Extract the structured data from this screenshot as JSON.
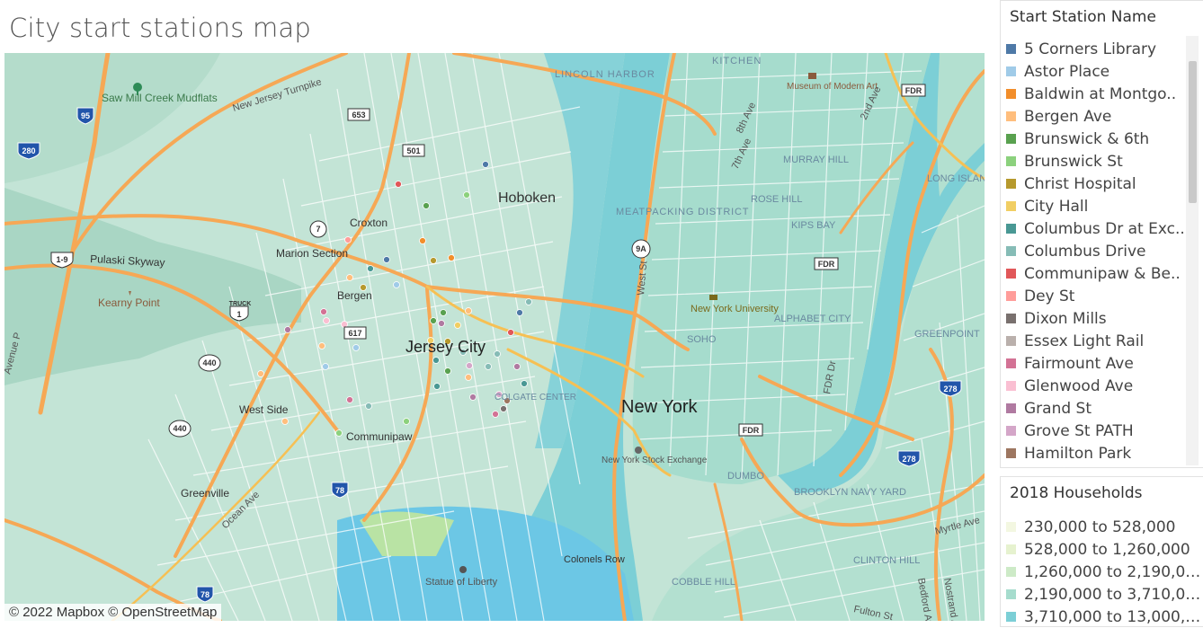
{
  "title": "City start stations map",
  "station_legend": {
    "title": "Start Station Name",
    "items": [
      {
        "label": "5 Corners Library",
        "color": "#4e79a7"
      },
      {
        "label": "Astor Place",
        "color": "#a0cbe8"
      },
      {
        "label": "Baldwin at Montgo..",
        "color": "#f28e2b"
      },
      {
        "label": "Bergen Ave",
        "color": "#ffbe7d"
      },
      {
        "label": "Brunswick & 6th",
        "color": "#59a14f"
      },
      {
        "label": "Brunswick St",
        "color": "#8cd17d"
      },
      {
        "label": "Christ Hospital",
        "color": "#b6992d"
      },
      {
        "label": "City Hall",
        "color": "#f1ce63"
      },
      {
        "label": "Columbus Dr at Exc..",
        "color": "#499894"
      },
      {
        "label": "Columbus Drive",
        "color": "#86bcb6"
      },
      {
        "label": "Communipaw & Be..",
        "color": "#e15759"
      },
      {
        "label": "Dey St",
        "color": "#ff9d9a"
      },
      {
        "label": "Dixon Mills",
        "color": "#79706e"
      },
      {
        "label": "Essex Light Rail",
        "color": "#bab0ac"
      },
      {
        "label": "Fairmount Ave",
        "color": "#d37295"
      },
      {
        "label": "Glenwood Ave",
        "color": "#fabfd2"
      },
      {
        "label": "Grand St",
        "color": "#b07aa1"
      },
      {
        "label": "Grove St PATH",
        "color": "#d4a6c8"
      },
      {
        "label": "Hamilton Park",
        "color": "#9d7660"
      }
    ]
  },
  "households_legend": {
    "title": "2018 Households",
    "items": [
      {
        "label": "230,000 to 528,000",
        "color": "#f3f7e1"
      },
      {
        "label": "528,000 to 1,260,000",
        "color": "#e6f2cf"
      },
      {
        "label": "1,260,000 to 2,190,000",
        "color": "#cdeac7"
      },
      {
        "label": "2,190,000 to 3,710,000",
        "color": "#a6dccd"
      },
      {
        "label": "3,710,000 to 13,000,0..",
        "color": "#7ccfd6"
      }
    ]
  },
  "map": {
    "attribution": "© 2022 Mapbox © OpenStreetMap",
    "places": {
      "saw_mill": "Saw Mill Creek Mudflats",
      "nj_turnpike": "New Jersey Turnpike",
      "lincoln_harbor": "LINCOLN HARBOR",
      "kitchen": "KITCHEN",
      "moma": "Museum of Modern Art",
      "hoboken": "Hoboken",
      "croxton": "Croxton",
      "marion": "Marion Section",
      "pulaski": "Pulaski Skyway",
      "kearny": "Kearny Point",
      "bergen": "Bergen",
      "jersey_city": "Jersey City",
      "colgate": "COLGATE CENTER",
      "west_side": "West Side",
      "communipaw": "Communipaw",
      "greenville": "Greenville",
      "ocean_ave": "Ocean Ave",
      "avenue_p": "Avenue P",
      "meatpacking": "MEATPACKING DISTRICT",
      "west_st": "West St",
      "nyu": "New York University",
      "soho": "SOHO",
      "new_york": "New York",
      "nyse": "New York Stock Exchange",
      "murray_hill": "MURRAY HILL",
      "rose_hill": "ROSE HILL",
      "kips_bay": "KIPS BAY",
      "alphabet_city": "ALPHABET CITY",
      "long_island_city": "LONG ISLAND CITY",
      "greenpoint": "GREENPOINT",
      "dumbo": "DUMBO",
      "brooklyn_navy": "BROOKLYN NAVY YARD",
      "clinton_hill": "CLINTON HILL",
      "cobble_hill": "COBBLE HILL",
      "statue": "Statue of Liberty",
      "colonels_row": "Colonels Row",
      "fdr_dr": "FDR Dr",
      "seventh_ave": "7th Ave",
      "eighth_ave": "8th Ave",
      "second_ave": "2nd Ave",
      "myrtle": "Myrtle Ave",
      "bedford": "Bedford Ave",
      "nostrand": "Nostrand Ave",
      "fulton": "Fulton St"
    },
    "shields": {
      "i95": "95",
      "i280": "280",
      "r653": "653",
      "r501": "501",
      "r7": "7",
      "us1_9": "1-9",
      "truck": "TRUCK",
      "us1": "1",
      "r617": "617",
      "r440a": "440",
      "r440b": "440",
      "i78a": "78",
      "i78b": "78",
      "r9a": "9A",
      "fdr1": "FDR",
      "fdr2": "FDR",
      "fdr3": "FDR",
      "i278a": "278",
      "i278b": "278"
    }
  }
}
